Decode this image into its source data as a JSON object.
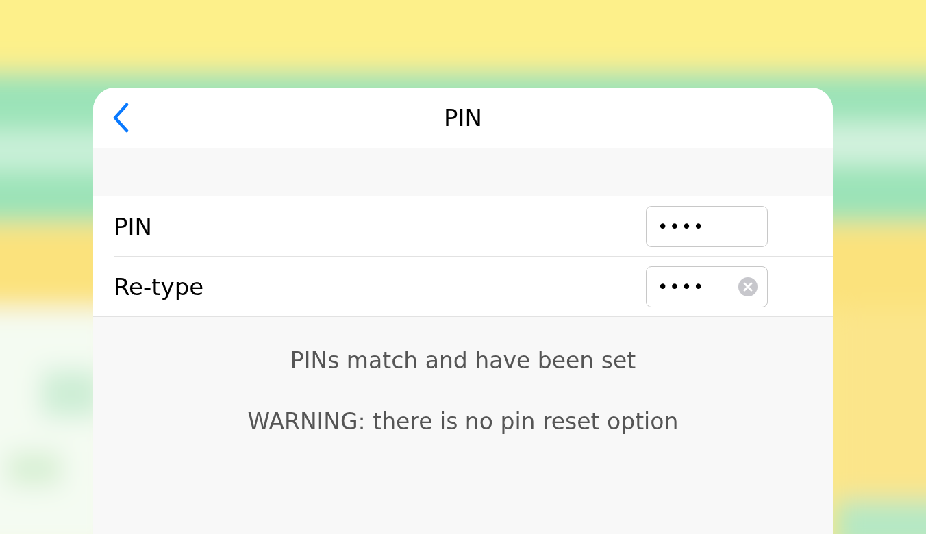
{
  "header": {
    "title": "PIN"
  },
  "fields": [
    {
      "label": "PIN",
      "value": "••••",
      "clearable": false
    },
    {
      "label": "Re-type",
      "value": "••••",
      "clearable": true
    }
  ],
  "messages": [
    "PINs match and have been set",
    "WARNING: there is no pin reset option"
  ]
}
